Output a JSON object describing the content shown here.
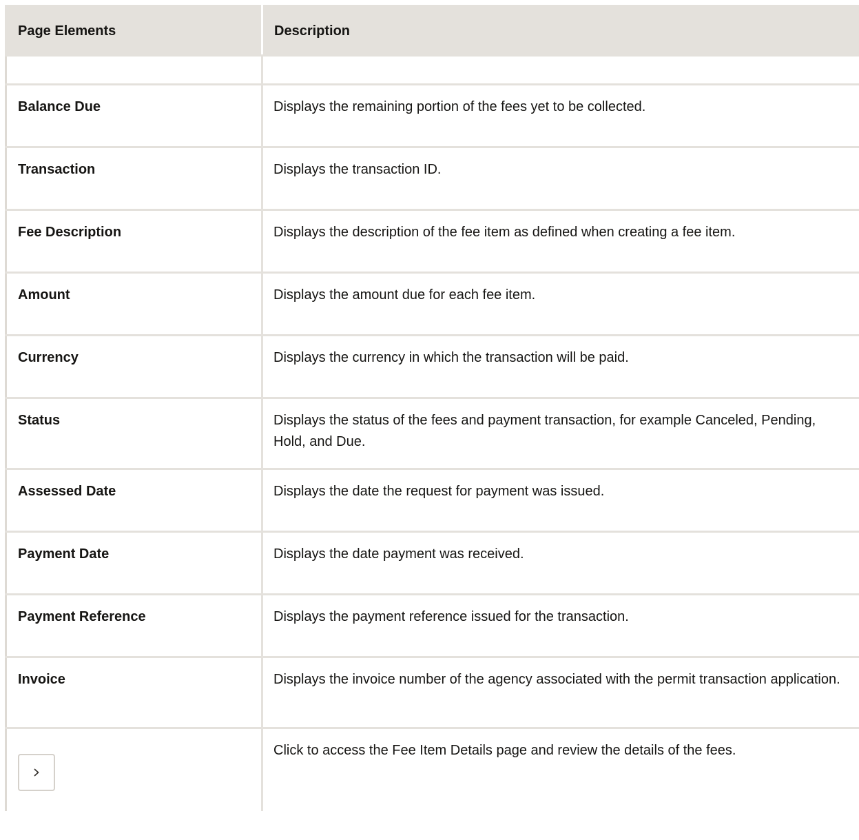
{
  "table": {
    "headers": [
      "Page Elements",
      "Description"
    ],
    "rows": [
      {
        "element": "",
        "description": ""
      },
      {
        "element": "Balance Due",
        "description": "Displays the remaining portion of the fees yet to be collected."
      },
      {
        "element": "Transaction",
        "description": "Displays the transaction ID."
      },
      {
        "element": "Fee Description",
        "description": "Displays the description of the fee item as defined when creating a fee item."
      },
      {
        "element": "Amount",
        "description": "Displays the amount due for each fee item."
      },
      {
        "element": "Currency",
        "description": "Displays the currency in which the transaction will be paid."
      },
      {
        "element": "Status",
        "description": "Displays the status of the fees and payment transaction, for example Canceled, Pending, Hold, and Due."
      },
      {
        "element": "Assessed Date",
        "description": "Displays the date the request for payment was issued."
      },
      {
        "element": "Payment Date",
        "description": "Displays the date payment was received."
      },
      {
        "element": "Payment Reference",
        "description": "Displays the payment reference issued for the transaction."
      },
      {
        "element": "Invoice",
        "description": "Displays the invoice number of the agency associated with the permit transaction application."
      },
      {
        "element_icon": "chevron-right-icon",
        "description": "Click to access the Fee Item Details page and review the details of the fees."
      }
    ]
  }
}
